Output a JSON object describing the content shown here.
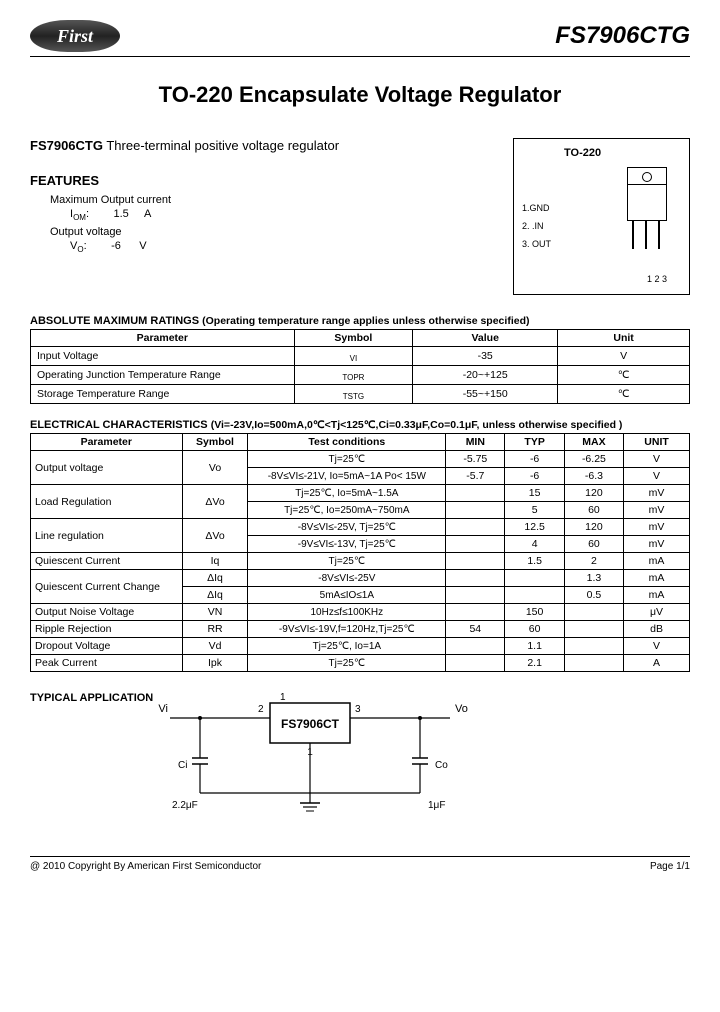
{
  "header": {
    "logo_text": "First",
    "part_number": "FS7906CTG"
  },
  "title": "TO-220 Encapsulate Voltage Regulator",
  "subtitle_bold": "FS7906CTG",
  "subtitle_rest": " Three-terminal positive voltage regulator",
  "features": {
    "heading": "FEATURES",
    "max_output_label": "Maximum Output current",
    "iom_label": "I",
    "iom_sub": "OM",
    "iom_val": "1.5",
    "iom_unit": "A",
    "vout_label": "Output voltage",
    "vo_label": "V",
    "vo_sub": "O",
    "vo_val": "-6",
    "vo_unit": "V"
  },
  "package": {
    "label": "TO-220",
    "pin1": "1.GND",
    "pin2": "2. .IN",
    "pin3": "3. OUT",
    "pins_lbl": "1 2 3"
  },
  "abs": {
    "title": "ABSOLUTE MAXIMUM RATINGS",
    "title_note": "(Operating temperature range applies unless otherwise specified)",
    "headers": [
      "Parameter",
      "Symbol",
      "Value",
      "Unit"
    ],
    "rows": [
      {
        "param": "Input Voltage",
        "sym": "VI",
        "val": "-35",
        "unit": "V"
      },
      {
        "param": "Operating Junction Temperature Range",
        "sym": "TOPR",
        "val": "-20~+125",
        "unit": "℃"
      },
      {
        "param": "Storage Temperature Range",
        "sym": "TSTG",
        "val": "-55~+150",
        "unit": "℃"
      }
    ]
  },
  "elec": {
    "title": "ELECTRICAL CHARACTERISTICS",
    "title_note": "(Vi=-23V,Io=500mA,0℃<Tj<125℃,Ci=0.33μF,Co=0.1μF, unless otherwise specified )",
    "headers": [
      "Parameter",
      "Symbol",
      "Test conditions",
      "MIN",
      "TYP",
      "MAX",
      "UNIT"
    ],
    "rows": [
      {
        "param": "Output voltage",
        "sym": "Vo",
        "cond": "Tj=25℃",
        "min": "-5.75",
        "typ": "-6",
        "max": "-6.25",
        "unit": "V",
        "rowspan_p": 2,
        "rowspan_s": 2
      },
      {
        "cond": "-8V≤VI≤-21V, Io=5mA~1A Po< 15W",
        "min": "-5.7",
        "typ": "-6",
        "max": "-6.3",
        "unit": "V"
      },
      {
        "param": "Load Regulation",
        "sym": "ΔVo",
        "cond": "Tj=25℃, Io=5mA~1.5A",
        "min": "",
        "typ": "15",
        "max": "120",
        "unit": "mV",
        "rowspan_p": 2,
        "rowspan_s": 2
      },
      {
        "cond": "Tj=25℃, Io=250mA~750mA",
        "min": "",
        "typ": "5",
        "max": "60",
        "unit": "mV"
      },
      {
        "param": "Line regulation",
        "sym": "ΔVo",
        "cond": "-8V≤VI≤-25V, Tj=25℃",
        "min": "",
        "typ": "12.5",
        "max": "120",
        "unit": "mV",
        "rowspan_p": 2,
        "rowspan_s": 2
      },
      {
        "cond": "-9V≤VI≤-13V, Tj=25℃",
        "min": "",
        "typ": "4",
        "max": "60",
        "unit": "mV"
      },
      {
        "param": "Quiescent Current",
        "sym": "Iq",
        "cond": "Tj=25℃",
        "min": "",
        "typ": "1.5",
        "max": "2",
        "unit": "mA"
      },
      {
        "param": "Quiescent Current Change",
        "sym": "ΔIq",
        "cond": "-8V≤VI≤-25V",
        "min": "",
        "typ": "",
        "max": "1.3",
        "unit": "mA",
        "rowspan_p": 2
      },
      {
        "sym": "ΔIq",
        "cond": "5mA≤IO≤1A",
        "min": "",
        "typ": "",
        "max": "0.5",
        "unit": "mA"
      },
      {
        "param": "Output Noise Voltage",
        "sym": "VN",
        "cond": "10Hz≤f≤100KHz",
        "min": "",
        "typ": "150",
        "max": "",
        "unit": "μV"
      },
      {
        "param": "Ripple Rejection",
        "sym": "RR",
        "cond": "-9V≤VI≤-19V,f=120Hz,Tj=25℃",
        "min": "54",
        "typ": "60",
        "max": "",
        "unit": "dB"
      },
      {
        "param": "Dropout Voltage",
        "sym": "Vd",
        "cond": "Tj=25℃, Io=1A",
        "min": "",
        "typ": "1.1",
        "max": "",
        "unit": "V"
      },
      {
        "param": "Peak Current",
        "sym": "Ipk",
        "cond": "Tj=25℃",
        "min": "",
        "typ": "2.1",
        "max": "",
        "unit": "A"
      }
    ]
  },
  "app": {
    "heading": "TYPICAL APPLICATION",
    "vi": "Vi",
    "vo": "Vo",
    "pin2": "2",
    "pin1": "1",
    "pin3": "3",
    "chip": "FS7906CT",
    "ci_label": "Ci",
    "ci_val": "2.2μF",
    "co_label": "Co",
    "co_val": "1μF"
  },
  "footer": {
    "copyright": "@ 2010 Copyright By American First Semiconductor",
    "page": "Page 1/1"
  }
}
